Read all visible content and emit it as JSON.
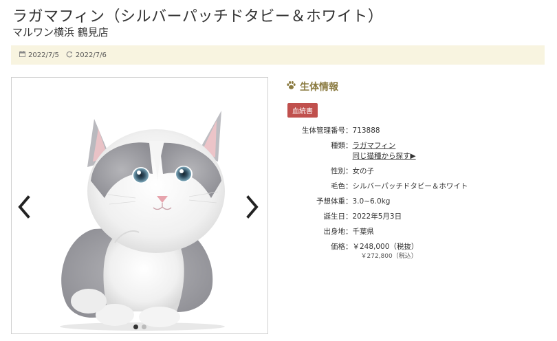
{
  "header": {
    "title": "ラガマフィン（シルバーパッチドタビー＆ホワイト）",
    "shop": "マルワン横浜 鶴見店"
  },
  "dates": {
    "registered": "2022/7/5",
    "updated": "2022/7/6"
  },
  "info": {
    "heading": "生体情報",
    "badge": "血統書",
    "rows": [
      {
        "key": "生体管理番号",
        "value": "713888"
      },
      {
        "key": "種類",
        "value": "ラガマフィン",
        "link2": "同じ猫種から探す▶"
      },
      {
        "key": "性別",
        "value": "女の子"
      },
      {
        "key": "毛色",
        "value": "シルバーパッチドタビー＆ホワイト"
      },
      {
        "key": "予想体重",
        "value": "3.0~6.0kg"
      },
      {
        "key": "誕生日",
        "value": "2022年5月3日"
      },
      {
        "key": "出身地",
        "value": "千葉県"
      },
      {
        "key": "価格",
        "value": "￥248,000（税抜）",
        "sub": "￥272,800（税込）"
      }
    ],
    "colon": "："
  },
  "gallery": {
    "current": 1,
    "total": 2
  },
  "icons": {
    "calendar": "calendar-icon",
    "refresh": "refresh-icon",
    "paw": "paw-icon",
    "prev": "chevron-left-icon",
    "next": "chevron-right-icon"
  },
  "colors": {
    "accent": "#8a7a40",
    "badge": "#c0504d",
    "date_bar": "#f8f4e0"
  }
}
